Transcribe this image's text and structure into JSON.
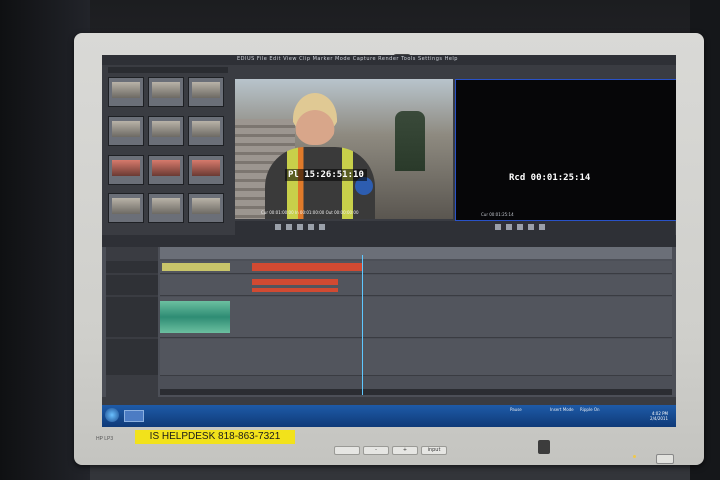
{
  "monitor": {
    "brand_logo": "hp",
    "model_label": "HP LP3",
    "helpdesk_label": "IS HELPDESK 818-863-7321",
    "bottom_buttons": [
      "",
      "-",
      "+",
      "input"
    ]
  },
  "app": {
    "menu": "EDIUS  File  Edit  View  Clip  Marker  Mode  Capture  Render  Tools  Settings  Help",
    "player_timecode": "Pl 15:26:51:10",
    "recorder_timecode": "Rcd 00:01:25:14",
    "player_footer": "Cur 00:01:00:00    In 00:01:00:00    Out 00:00:00:00",
    "recorder_footer": "Cur 00:01:25:14"
  },
  "taskbar": {
    "status_items": [
      "Pause",
      "Insert Mode",
      "Ripple On"
    ],
    "clock": "4:02 PM",
    "date": "2/4/2011"
  }
}
